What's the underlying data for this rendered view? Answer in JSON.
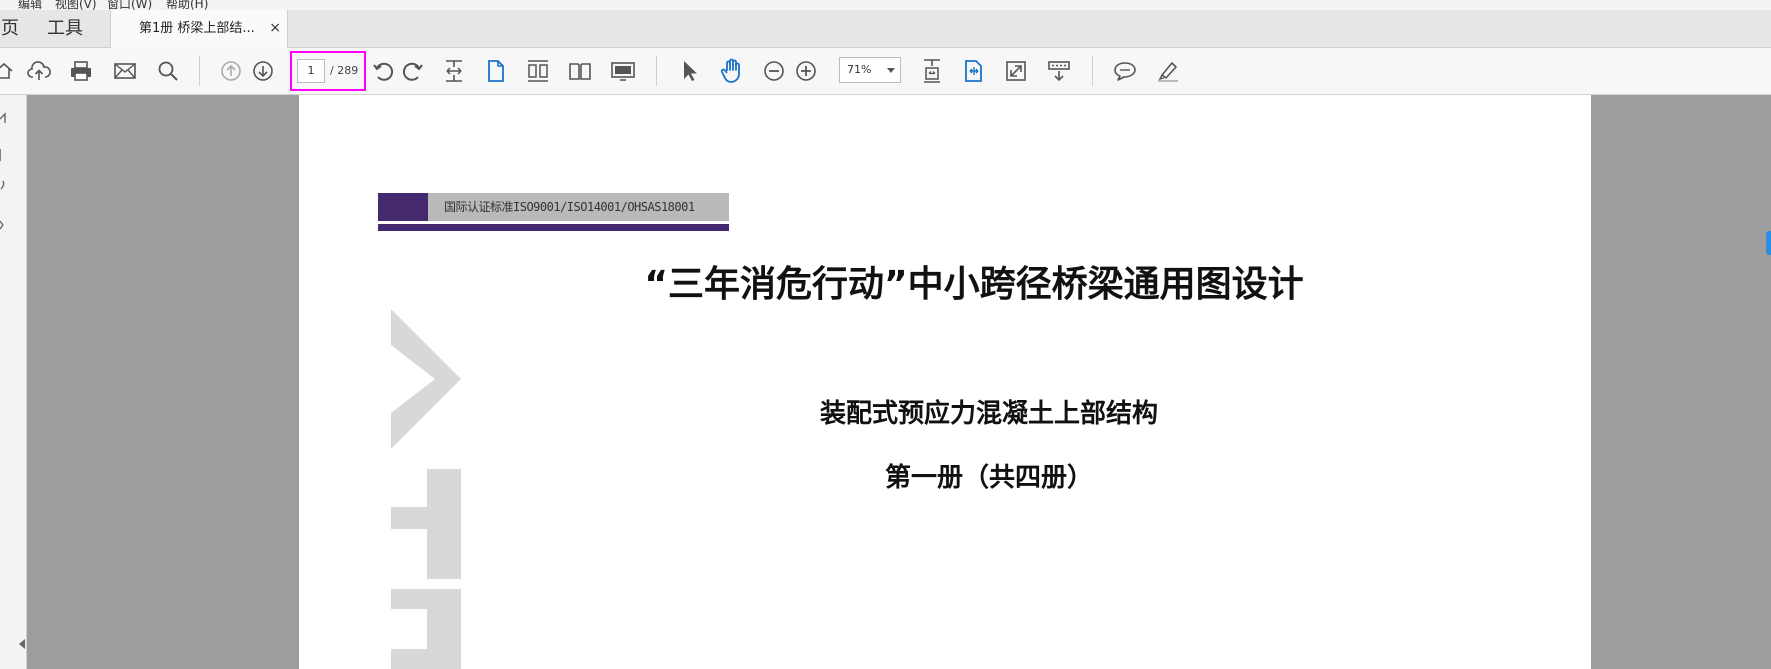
{
  "menu": [
    "编辑",
    "视图(V)",
    "窗口(W)",
    "帮助(H)"
  ],
  "tabs": {
    "home": "主页",
    "tools": "工具",
    "document": "第1册 桥梁上部结...",
    "close": "×"
  },
  "toolbar": {
    "page_current": "1",
    "page_total": "/ 289",
    "zoom": "71%",
    "icons": [
      "home-icon",
      "cloud-upload-icon",
      "print-icon",
      "mail-icon",
      "search-icon",
      "prev-page-icon",
      "next-page-icon",
      "rotate-counterclockwise-icon",
      "rotate-clockwise-icon",
      "fit-width-icon",
      "single-page-icon",
      "two-page-scroll-icon",
      "two-page-icon",
      "presentation-icon",
      "select-cursor-icon",
      "hand-tool-icon",
      "zoom-out-icon",
      "zoom-in-icon",
      "fit-page-icon",
      "marquee-zoom-icon",
      "full-screen-icon",
      "read-mode-icon",
      "comment-icon",
      "highlight-pen-icon"
    ]
  },
  "document": {
    "certification": "国际认证标准ISO9001/ISO14001/OHSAS18001",
    "title": "“三年消危行动”中小跨径桥梁通用图设计",
    "subtitle": "装配式预应力混凝土上部结构",
    "volume": "第一册（共四册）"
  },
  "colors": {
    "brand_purple": "#45296e",
    "highlight": "#ff00ff",
    "accent_blue": "#1a73c8",
    "doc_background": "#9d9d9d"
  }
}
